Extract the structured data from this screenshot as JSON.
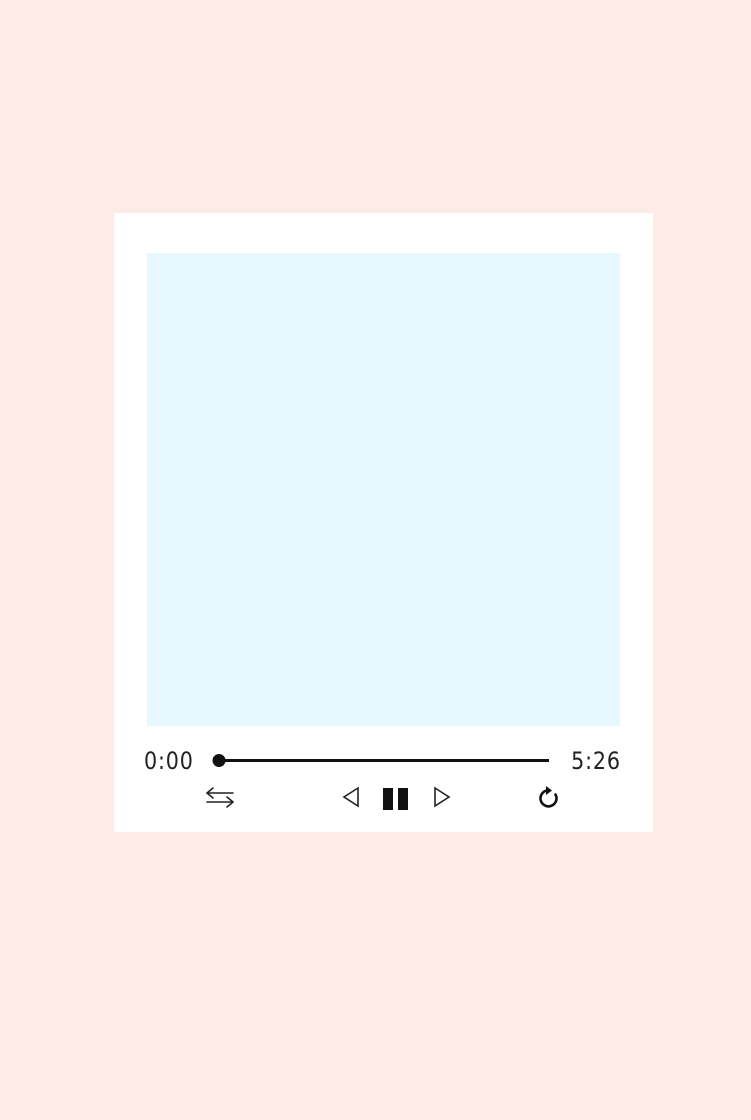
{
  "player": {
    "elapsed": "0:00",
    "duration": "5:26",
    "progress_fraction": 0.0
  },
  "controls": {
    "shuffle_icon": "shuffle-arrows-icon",
    "prev_icon": "previous-triangle-icon",
    "pause_icon": "pause-icon",
    "next_icon": "next-triangle-icon",
    "repeat_icon": "repeat-icon"
  },
  "colors": {
    "background": "#fdebe8",
    "card": "#ffffff",
    "artwork": "#e6f7fd",
    "foreground": "#111111"
  }
}
